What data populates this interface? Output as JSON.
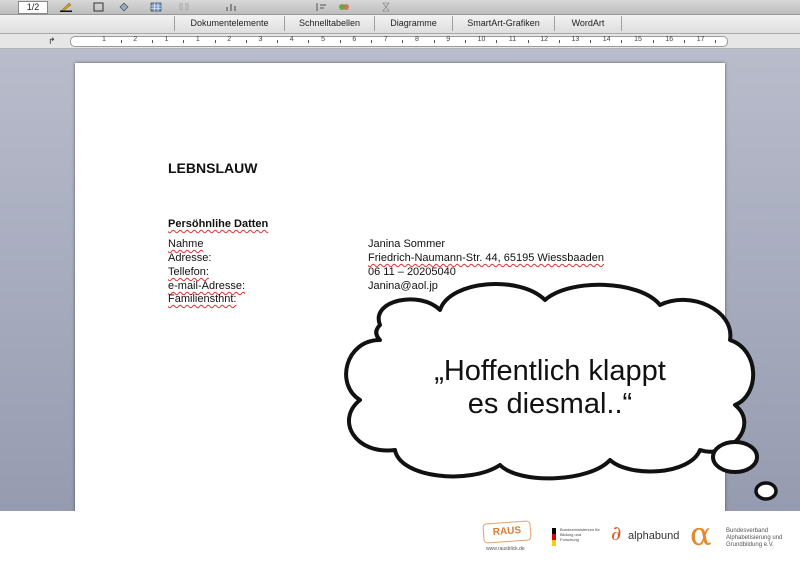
{
  "toolbar": {
    "page_indicator": "1/2",
    "icons": [
      "pen-icon",
      "border-icon",
      "paint-bucket-icon",
      "table-icon",
      "columns-icon",
      "chart-icon",
      "sort-icon",
      "media-icon"
    ]
  },
  "ribbon_tabs": [
    "Dokumentelemente",
    "Schnelltabellen",
    "Diagramme",
    "SmartArt-Grafiken",
    "WordArt"
  ],
  "ruler": {
    "numbers": [
      "1",
      "2",
      "1",
      "1",
      "2",
      "3",
      "4",
      "5",
      "6",
      "7",
      "8",
      "9",
      "10",
      "11",
      "12",
      "13",
      "14",
      "15",
      "16",
      "17"
    ]
  },
  "document": {
    "title": "LEBNSLAUW",
    "section_heading": "Persöhnlihe Datten",
    "fields": [
      {
        "label": "Nahme",
        "value": "Janina Sommer"
      },
      {
        "label": "Adresse:",
        "value": "Friedrich-Naumann-Str. 44, 65195 Wiessbaaden"
      },
      {
        "label": "Tellefon:",
        "value": "06 11 – 20205040"
      },
      {
        "label": "e-mail-Adresse:",
        "value": "Janina@aol.jp"
      },
      {
        "label": "Familiensthnt:",
        "value": ""
      }
    ]
  },
  "thought_bubble": {
    "line1": "„Hoffentlich klappt",
    "line2": "es diesmal..“"
  },
  "footer": {
    "raus_logo": "RAUS",
    "raus_url": "www.rausblick.de",
    "bmbf_text": "Bundesministerium für Bildung und Forschung",
    "alphabund_mark": "∂",
    "alphabund_name": "alphabund",
    "bv_mark": "α",
    "bv_text": "Bundesverband Alphabetisierung und Grundbildung e.V."
  },
  "colors": {
    "accent_orange": "#e4882c",
    "spell_error": "#e03030",
    "workspace": "#a8acbf"
  }
}
